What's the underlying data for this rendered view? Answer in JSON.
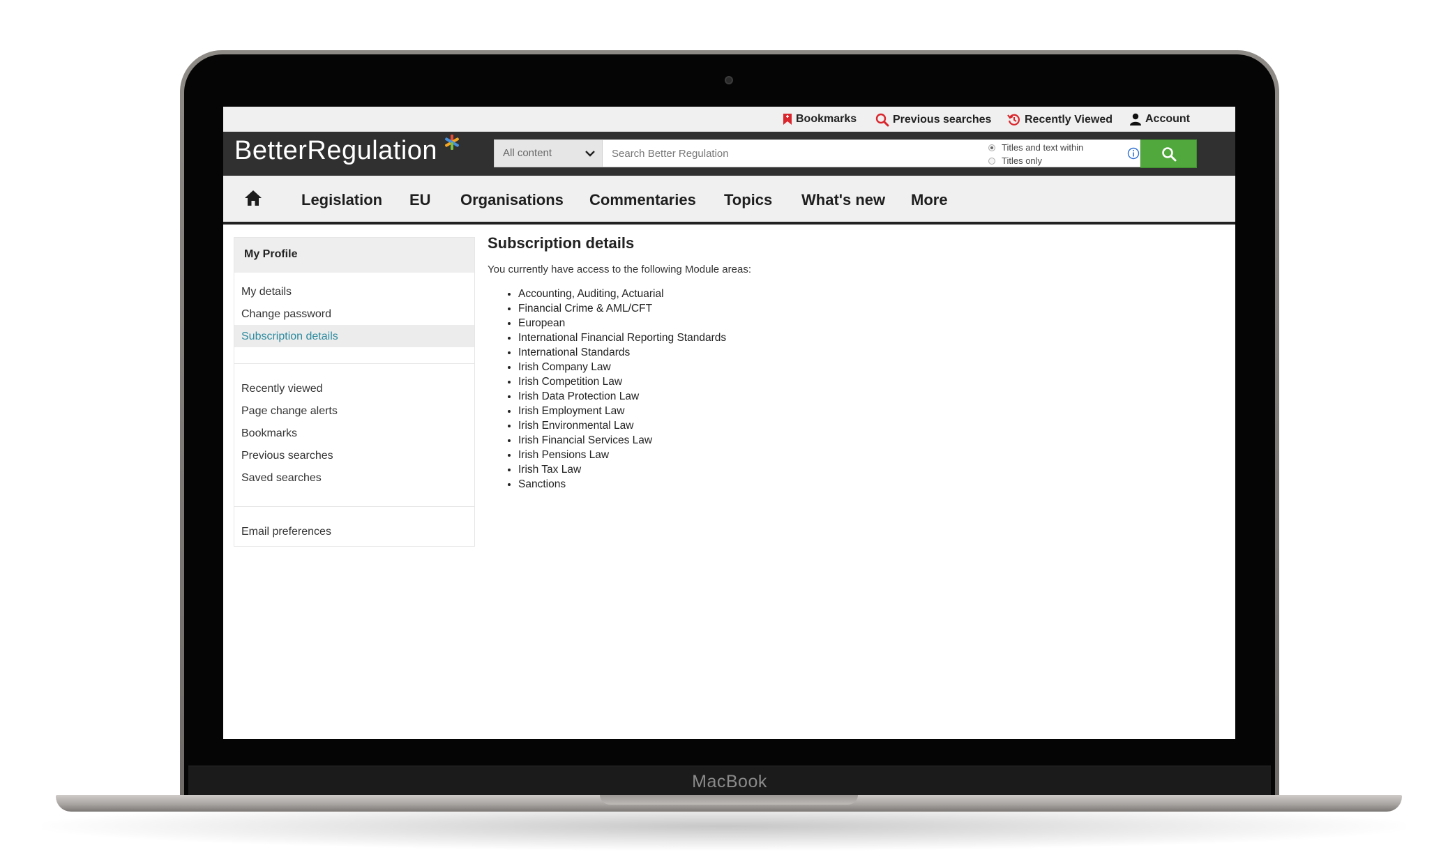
{
  "utility_bar": {
    "bookmarks": "Bookmarks",
    "previous_searches": "Previous searches",
    "recently_viewed": "Recently Viewed",
    "account": "Account"
  },
  "header": {
    "logo_text": "BetterRegulation",
    "search": {
      "scope_value": "All content",
      "placeholder": "Search Better Regulation",
      "option_titles_and_text": "Titles and text within",
      "option_titles_only": "Titles only",
      "selected_option": "Titles and text within"
    }
  },
  "nav": {
    "items": [
      "Legislation",
      "EU",
      "Organisations",
      "Commentaries",
      "Topics",
      "What's new",
      "More"
    ]
  },
  "sidebar": {
    "title": "My Profile",
    "group1": [
      "My details",
      "Change password",
      "Subscription details"
    ],
    "group2": [
      "Recently viewed",
      "Page change alerts",
      "Bookmarks",
      "Previous searches",
      "Saved searches"
    ],
    "group3": [
      "Email preferences"
    ],
    "active_item": "Subscription details"
  },
  "content": {
    "title": "Subscription details",
    "intro": "You currently have access to the following Module areas:",
    "modules": [
      "Accounting, Auditing, Actuarial",
      "Financial Crime & AML/CFT",
      "European",
      "International Financial Reporting Standards",
      "International Standards",
      "Irish Company Law",
      "Irish Competition Law",
      "Irish Data Protection Law",
      "Irish Employment Law",
      "Irish Environmental Law",
      "Irish Financial Services Law",
      "Irish Pensions Law",
      "Irish Tax Law",
      "Sanctions"
    ]
  },
  "device": {
    "brand_label": "MacBook"
  },
  "colors": {
    "header_bg": "#303030",
    "search_button": "#51a83c",
    "active_link": "#2b8a9e",
    "icon_red": "#d9262c",
    "info_blue": "#2f6fd0"
  }
}
